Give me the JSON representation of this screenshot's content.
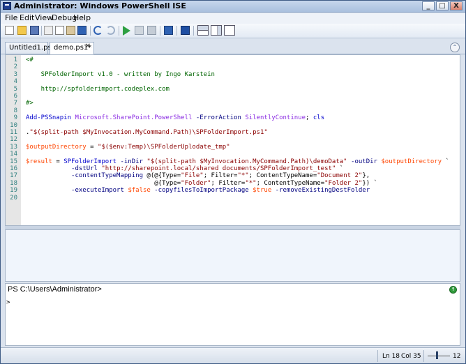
{
  "window": {
    "title": "Administrator: Windows PowerShell ISE"
  },
  "titlebar_buttons": {
    "minimize": "_",
    "maximize": "□",
    "close": "X"
  },
  "menu": [
    "File",
    "Edit",
    "View",
    "Debug",
    "Help"
  ],
  "toolbar": [
    "new-file-icon",
    "open-folder-icon",
    "save-icon",
    "cut-icon",
    "copy-icon",
    "paste-icon",
    "clear-icon",
    "undo-icon",
    "redo-icon",
    "run-script-icon",
    "run-selection-icon",
    "stop-icon",
    "new-remote-tab-icon",
    "powershell-icon",
    "layout-top-icon",
    "layout-right-icon",
    "layout-max-icon"
  ],
  "tabs": [
    {
      "label": "Untitled1.ps1",
      "active": false
    },
    {
      "label": "demo.ps1*",
      "active": true,
      "close": "✕"
    }
  ],
  "collapse_glyph": "⌃",
  "editor": {
    "line_numbers": [
      "1",
      "2",
      "3",
      "4",
      "5",
      "6",
      "7",
      "8",
      "9",
      "10",
      "11",
      "12",
      "13",
      "14",
      "15",
      "16",
      "17",
      "18",
      "19",
      "20"
    ],
    "lines": [
      {
        "n": 1,
        "tokens": [
          [
            "c-comment",
            "<#"
          ]
        ]
      },
      {
        "n": 2,
        "tokens": []
      },
      {
        "n": 3,
        "tokens": [
          [
            "c-comment",
            "    SPFolderImport v1.0 - written by Ingo Karstein"
          ]
        ]
      },
      {
        "n": 4,
        "tokens": []
      },
      {
        "n": 5,
        "tokens": [
          [
            "c-comment",
            "    http://spfolderimport.codeplex.com"
          ]
        ]
      },
      {
        "n": 6,
        "tokens": []
      },
      {
        "n": 7,
        "tokens": [
          [
            "c-comment",
            "#>"
          ]
        ]
      },
      {
        "n": 8,
        "tokens": []
      },
      {
        "n": 9,
        "tokens": [
          [
            "c-cmd",
            "Add-PSSnapin"
          ],
          [
            "",
            " "
          ],
          [
            "c-arg",
            "Microsoft.SharePoint.PowerShell"
          ],
          [
            "",
            " "
          ],
          [
            "c-param",
            "-ErrorAction"
          ],
          [
            "",
            " "
          ],
          [
            "c-arg",
            "SilentlyContinue"
          ],
          [
            "",
            "; "
          ],
          [
            "c-cmd",
            "cls"
          ]
        ]
      },
      {
        "n": 10,
        "tokens": []
      },
      {
        "n": 11,
        "tokens": [
          [
            "",
            "."
          ],
          [
            "c-str",
            "\"$(split-path $MyInvocation.MyCommand.Path)\\SPFolderImport.ps1\""
          ]
        ]
      },
      {
        "n": 12,
        "tokens": []
      },
      {
        "n": 13,
        "tokens": [
          [
            "c-var",
            "$outputDirectory"
          ],
          [
            "",
            " = "
          ],
          [
            "c-str",
            "\"$($env:Temp)\\SPFolderUplodate_tmp\""
          ]
        ]
      },
      {
        "n": 14,
        "tokens": []
      },
      {
        "n": 15,
        "tokens": [
          [
            "c-var",
            "$result"
          ],
          [
            "",
            " = "
          ],
          [
            "c-cmd",
            "SPFolderImport"
          ],
          [
            "",
            " "
          ],
          [
            "c-param",
            "-inDir"
          ],
          [
            "",
            " "
          ],
          [
            "c-str",
            "\"$(split-path $MyInvocation.MyCommand.Path)\\demoData\""
          ],
          [
            "",
            " "
          ],
          [
            "c-param",
            "-outDir"
          ],
          [
            "",
            " "
          ],
          [
            "c-var",
            "$outputDirectory"
          ],
          [
            "",
            " `"
          ]
        ]
      },
      {
        "n": 16,
        "tokens": [
          [
            "",
            "            "
          ],
          [
            "c-param",
            "-dstUrl"
          ],
          [
            "",
            " "
          ],
          [
            "c-str",
            "\"http://sharepoint.local/shared documents/SPFolderImport_test\""
          ],
          [
            "",
            " `"
          ]
        ]
      },
      {
        "n": 17,
        "tokens": [
          [
            "",
            "            "
          ],
          [
            "c-param",
            "-contentTypeMapping"
          ],
          [
            "",
            " @(@{Type="
          ],
          [
            "c-str",
            "\"File\""
          ],
          [
            "",
            "; Filter="
          ],
          [
            "c-str",
            "\"*\""
          ],
          [
            "",
            "; ContentTypeName="
          ],
          [
            "c-str",
            "\"Document 2\""
          ],
          [
            "",
            "},"
          ]
        ]
      },
      {
        "n": 18,
        "tokens": [
          [
            "",
            "                                  @{Type="
          ],
          [
            "c-str",
            "\"Folder\""
          ],
          [
            "",
            "; Filter="
          ],
          [
            "c-str",
            "\"*\""
          ],
          [
            "",
            "; ContentTypeName="
          ],
          [
            "c-str",
            "\"Folder 2\""
          ],
          [
            "",
            "}) `"
          ]
        ]
      },
      {
        "n": 19,
        "tokens": [
          [
            "",
            "            "
          ],
          [
            "c-param",
            "-executeImport"
          ],
          [
            "",
            " "
          ],
          [
            "c-var",
            "$false"
          ],
          [
            "",
            " "
          ],
          [
            "c-param",
            "-copyfilesToImportPackage"
          ],
          [
            "",
            " "
          ],
          [
            "c-var",
            "$true"
          ],
          [
            "",
            " "
          ],
          [
            "c-param",
            "-removeExistingDestFolder"
          ]
        ]
      },
      {
        "n": 20,
        "tokens": []
      }
    ]
  },
  "console": {
    "prompt": "PS C:\\Users\\Administrator>",
    "caret": ">",
    "run_glyph": "↑"
  },
  "status": {
    "line": "Ln 18",
    "col": "Col 35",
    "zoom": "12"
  }
}
